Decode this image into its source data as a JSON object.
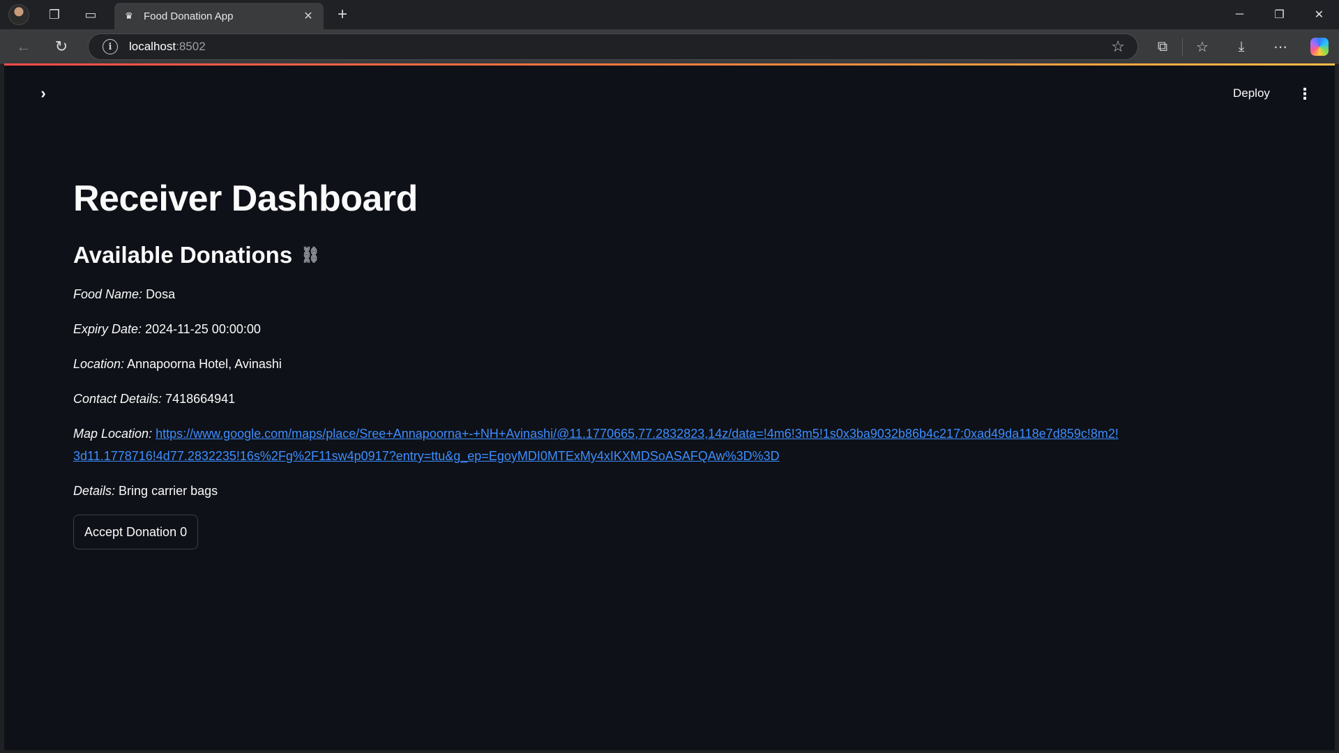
{
  "browser": {
    "tab_title": "Food Donation App",
    "url_host": "localhost",
    "url_port": ":8502"
  },
  "app": {
    "deploy_label": "Deploy",
    "page_title": "Receiver Dashboard",
    "section_title": "Available Donations",
    "donation": {
      "food_name_label": "Food Name:",
      "food_name": "Dosa",
      "expiry_label": "Expiry Date:",
      "expiry": "2024-11-25 00:00:00",
      "location_label": "Location:",
      "location": "Annapoorna Hotel, Avinashi",
      "contact_label": "Contact Details:",
      "contact": "7418664941",
      "map_label": "Map Location:",
      "map_url": "https://www.google.com/maps/place/Sree+Annapoorna+-+NH+Avinashi/@11.1770665,77.2832823,14z/data=!4m6!3m5!1s0x3ba9032b86b4c217:0xad49da118e7d859c!8m2!3d11.1778716!4d77.2832235!16s%2Fg%2F11sw4p0917?entry=ttu&g_ep=EgoyMDI0MTExMy4xIKXMDSoASAFQAw%3D%3D",
      "details_label": "Details:",
      "details": "Bring carrier bags",
      "accept_button": "Accept Donation 0"
    }
  },
  "icons": {
    "tab_favicon": "streamlit-crown-icon",
    "sidebar_toggle": "chevron-right-icon",
    "section_anchor": "link-icon",
    "menu": "kebab-menu-icon"
  },
  "colors": {
    "app_background": "#0e1117",
    "text": "#fafafa",
    "link": "#3d8dff",
    "accent_bar_start": "#ff4b4b",
    "accent_bar_end": "#ffbd45"
  }
}
